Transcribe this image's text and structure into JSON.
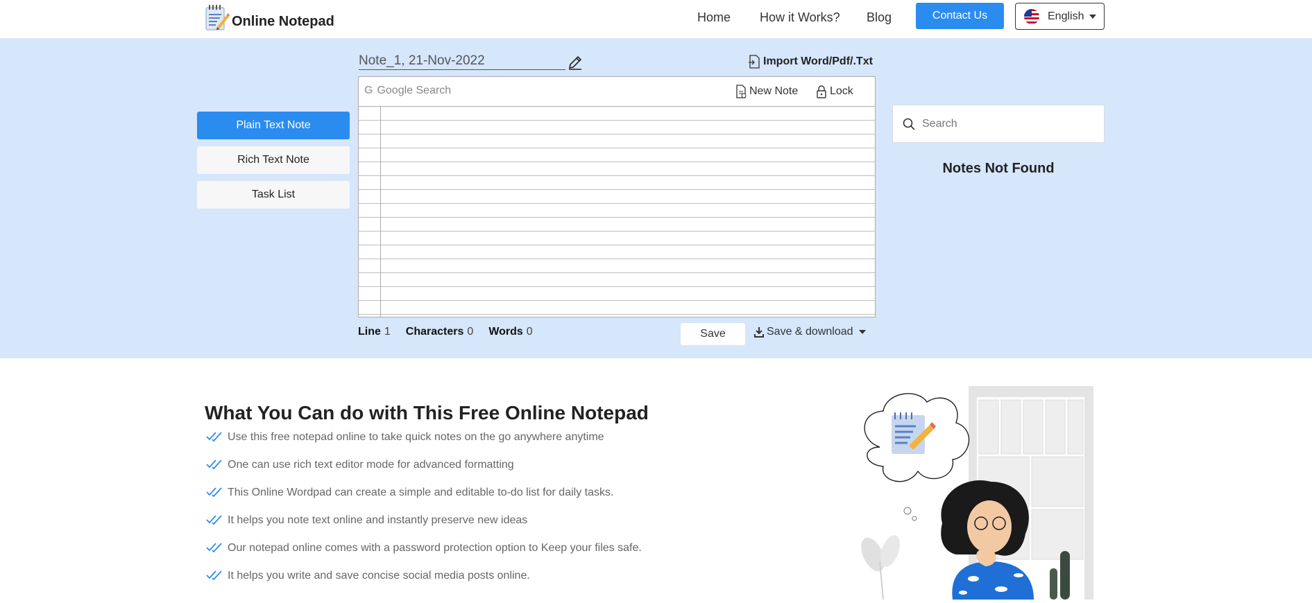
{
  "header": {
    "app_name": "Online Notepad",
    "nav": [
      "Home",
      "How it Works?",
      "Blog"
    ],
    "contact_label": "Contact Us",
    "language": "English"
  },
  "sidebar": {
    "items": [
      {
        "label": "Plain Text Note",
        "active": true
      },
      {
        "label": "Rich Text Note",
        "active": false
      },
      {
        "label": "Task List",
        "active": false
      }
    ]
  },
  "editor": {
    "note_title": "Note_1, 21-Nov-2022",
    "import_label": "Import Word/Pdf/.Txt",
    "google_search_placeholder": "Google Search",
    "new_note_label": "New Note",
    "lock_label": "Lock",
    "stats": {
      "line_label": "Line",
      "line_value": "1",
      "chars_label": "Characters",
      "chars_value": "0",
      "words_label": "Words",
      "words_value": "0"
    },
    "save_label": "Save",
    "save_download_label": "Save & download"
  },
  "notes_panel": {
    "search_placeholder": "Search",
    "empty_message": "Notes Not Found"
  },
  "features": {
    "title": "What You Can do with This Free Online Notepad",
    "items": [
      "Use this free notepad online to take quick notes on the go anywhere anytime",
      "One can use rich text editor mode for advanced formatting",
      "This Online Wordpad can create a simple and editable to-do list for daily tasks.",
      "It helps you note text online and instantly preserve new ideas",
      "Our notepad online comes with a password protection option to Keep your files safe.",
      "It helps you write and save concise social media posts online."
    ]
  },
  "colors": {
    "accent": "#2b8cf0",
    "band": "#d6e6fb",
    "check": "#2b8cf0"
  }
}
